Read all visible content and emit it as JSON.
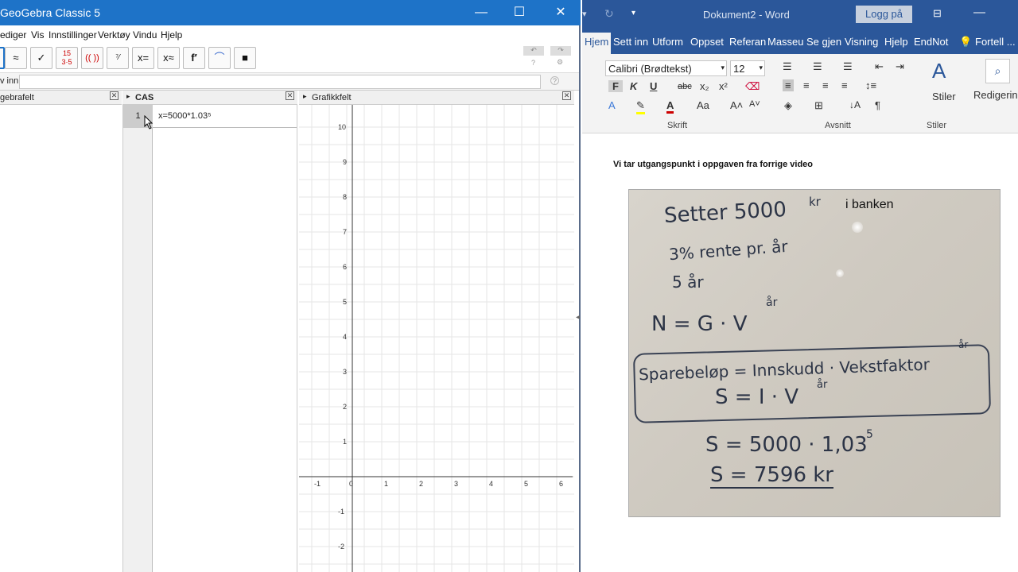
{
  "geogebra": {
    "title": "GeoGebra Classic 5",
    "menu": [
      "ediger",
      "Vis",
      "Innstillinger",
      "Verktøy",
      "Vindu",
      "Hjelp"
    ],
    "tools": [
      "≈",
      "✓",
      "15\n3·5",
      "(( ))",
      "⁷⁄",
      "x=",
      "x≈",
      "f′",
      "⌒",
      "🗑"
    ],
    "input_label": "v inn:",
    "input_value": "",
    "algebra_header": "gebrafelt",
    "cas_header": "CAS",
    "graphics_header": "Grafikkfelt",
    "cas_rows": [
      {
        "num": "1",
        "input": "x=5000*1.03⁵"
      }
    ],
    "x_ticks": [
      "-1",
      "0",
      "1",
      "2",
      "3",
      "4",
      "5",
      "6"
    ],
    "y_ticks": [
      "10",
      "9",
      "8",
      "7",
      "6",
      "5",
      "4",
      "3",
      "2",
      "1",
      "-1",
      "-2"
    ]
  },
  "word": {
    "title": "Dokument2  -  Word",
    "login": "Logg på",
    "tabs": [
      "Hjem",
      "Sett inn",
      "Utform",
      "Oppset",
      "Referan",
      "Masseu",
      "Se gjen",
      "Visning",
      "Hjelp",
      "EndNot",
      "Fortell ..."
    ],
    "font_name": "Calibri (Brødtekst)",
    "font_size": "12",
    "groups": [
      "Skrift",
      "Avsnitt",
      "Stiler"
    ],
    "styles_label": "Stiler",
    "editing_label": "Redigering",
    "doc_text": "Vi tar utgangspunkt i oppgaven fra forrige video",
    "whiteboard": {
      "typed_label": "i banken",
      "lines": [
        "Setter 5000",
        "kr",
        "3% rente pr. år",
        "5 år",
        "N = G · V",
        "år",
        "Sparebeløp = Innskudd · Vekstfaktor",
        "år",
        "S = I · V",
        "år",
        "S = 5000 · 1,03",
        "5",
        "S = 7596 kr"
      ]
    }
  }
}
